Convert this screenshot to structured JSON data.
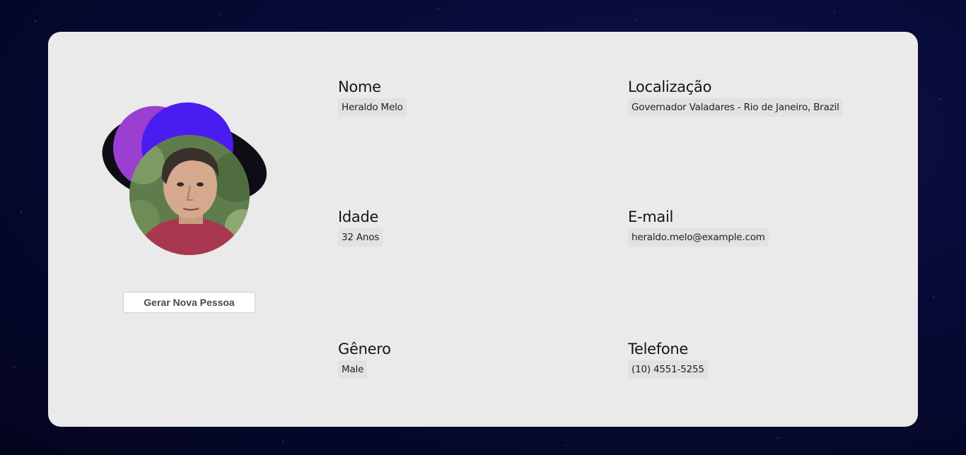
{
  "profile": {
    "avatar_alt": "Foto de perfil",
    "generate_button_label": "Gerar Nova Pessoa"
  },
  "fields": {
    "name": {
      "label": "Nome",
      "value": "Heraldo Melo"
    },
    "location": {
      "label": "Localização",
      "value": "Governador Valadares - Rio de Janeiro, Brazil"
    },
    "age": {
      "label": "Idade",
      "value": "32 Anos"
    },
    "email": {
      "label": "E-mail",
      "value": "heraldo.melo@example.com"
    },
    "gender": {
      "label": "Gênero",
      "value": "Male"
    },
    "phone": {
      "label": "Telefone",
      "value": "(10) 4551-5255"
    }
  },
  "colors": {
    "background": "#07093a",
    "card": "#eaeaea",
    "blob_purple": "#9a3fd0",
    "blob_blue": "#4a1cf0",
    "blob_black": "#0e0c14"
  }
}
